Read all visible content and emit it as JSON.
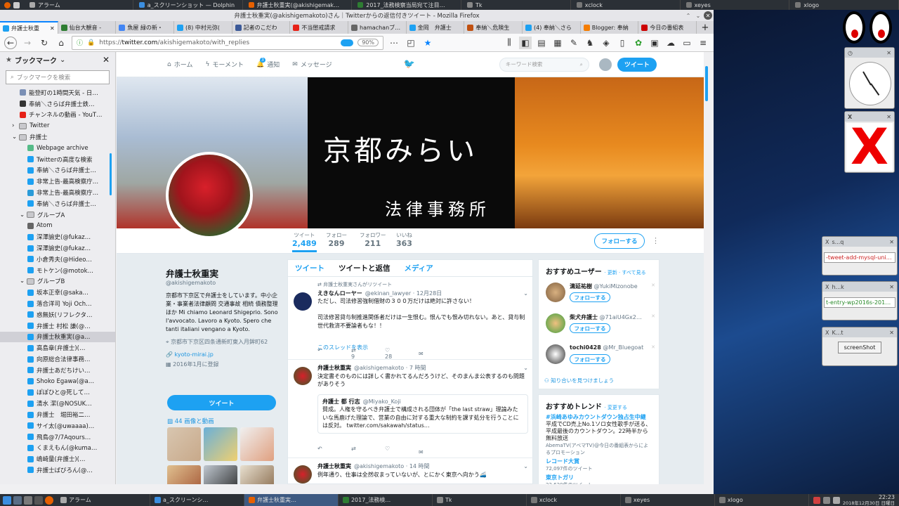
{
  "panel": {
    "items": [
      {
        "label": "アラーム"
      },
      {
        "label": "a_スクリーンショット — Dolphin"
      },
      {
        "label": "弁護士秋重実(@akishigemak…"
      },
      {
        "label": "2017_法務検察当局宛て注目…"
      },
      {
        "label": "Tk"
      },
      {
        "label": "xclock"
      },
      {
        "label": "xeyes"
      },
      {
        "label": "xlogo"
      }
    ]
  },
  "firefox": {
    "window_title": "弁護士秋重実(@akishigemakoto)さん｜Twitterからの返信付きツイート - Mozilla Firefox",
    "tabs": [
      {
        "label": "弁護士秋重"
      },
      {
        "label": "仙台大観音 - "
      },
      {
        "label": "魚屋 緑の新・"
      },
      {
        "label": "(8) 中村元弥("
      },
      {
        "label": "記者のこだわ"
      },
      {
        "label": "不当懲戒請求"
      },
      {
        "label": "hamachanブログ("
      },
      {
        "label": "金岡　弁護士"
      },
      {
        "label": "奉納＼危険生"
      },
      {
        "label": "(4) 奉納＼さら"
      },
      {
        "label": "Blogger: 奉納"
      },
      {
        "label": "今日の番組表"
      }
    ],
    "url_prefix": "https://",
    "url_domain": "twitter.com",
    "url_path": "/akishigemakoto/with_replies",
    "zoom": "90%"
  },
  "sidebar": {
    "title": "ブックマーク",
    "search_placeholder": "ブックマークを検索",
    "items": [
      {
        "label": "能登町の1時間天気 - 日…",
        "indent": 2,
        "icon": "#7a8fb5"
      },
      {
        "label": "奉納＼さらば弁護士鉄…",
        "indent": 2,
        "icon": "#333"
      },
      {
        "label": "チャンネルの動画 - YouT…",
        "indent": 2,
        "icon": "#e62117"
      },
      {
        "label": "Twitter",
        "indent": 1,
        "icon": "folder"
      },
      {
        "label": "弁護士",
        "indent": 1,
        "icon": "folder"
      },
      {
        "label": "Webpage archive",
        "indent": 3,
        "icon": "#5b8"
      },
      {
        "label": "Twitterの高度な検索",
        "indent": 3,
        "icon": "#1da1f2"
      },
      {
        "label": "奉納＼さらば弁護士…",
        "indent": 3,
        "icon": "#1da1f2"
      },
      {
        "label": "非常上告-最高検察庁…",
        "indent": 3,
        "icon": "#1da1f2"
      },
      {
        "label": "非常上告-最高検察庁…",
        "indent": 3,
        "icon": "#2a9bd8"
      },
      {
        "label": "奉納＼さらば弁護士…",
        "indent": 3,
        "icon": "#1da1f2"
      },
      {
        "label": "グループA",
        "indent": 2,
        "icon": "folder"
      },
      {
        "label": "Atom",
        "indent": 3,
        "icon": "#666"
      },
      {
        "label": "深澤諭史(@fukaz…",
        "indent": 3,
        "icon": "#1da1f2"
      },
      {
        "label": "深澤諭史(@fukaz…",
        "indent": 3,
        "icon": "#1da1f2"
      },
      {
        "label": "小倉秀夫(@Hideo…",
        "indent": 3,
        "icon": "#1da1f2"
      },
      {
        "label": "モトケン(@motok…",
        "indent": 3,
        "icon": "#1da1f2"
      },
      {
        "label": "グループB",
        "indent": 2,
        "icon": "folder"
      },
      {
        "label": "坂本正幸(@saka…",
        "indent": 3,
        "icon": "#1da1f2"
      },
      {
        "label": "落合洋司 Yoji Och…",
        "indent": 3,
        "icon": "#1da1f2"
      },
      {
        "label": "惑無妖(リフレクタ…",
        "indent": 3,
        "icon": "#1da1f2"
      },
      {
        "label": "弁護士 村松 謙(@…",
        "indent": 3,
        "icon": "#1da1f2"
      },
      {
        "label": "弁護士秋重実(@a…",
        "indent": 3,
        "icon": "#1da1f2",
        "selected": true
      },
      {
        "label": "高島章(弁護士)(…",
        "indent": 3,
        "icon": "#1da1f2"
      },
      {
        "label": "向原総合法律事務…",
        "indent": 3,
        "icon": "#1da1f2"
      },
      {
        "label": "弁護士あだちけい…",
        "indent": 3,
        "icon": "#1da1f2"
      },
      {
        "label": "Shoko Egawa(@a…",
        "indent": 3,
        "icon": "#1da1f2"
      },
      {
        "label": "ぽぽひと@死して…",
        "indent": 3,
        "icon": "#1da1f2"
      },
      {
        "label": "清水 潔(@NOSUK…",
        "indent": 3,
        "icon": "#1da1f2"
      },
      {
        "label": "弁護士　堀田裕二…",
        "indent": 3,
        "icon": "#1da1f2"
      },
      {
        "label": "サイ太(@uwaaaa)…",
        "indent": 3,
        "icon": "#1da1f2"
      },
      {
        "label": "飛鳥@7/7Aqours…",
        "indent": 3,
        "icon": "#1da1f2"
      },
      {
        "label": "くまえもん(@kuma…",
        "indent": 3,
        "icon": "#1da1f2"
      },
      {
        "label": "嶋崎量(弁護士)(…",
        "indent": 3,
        "icon": "#1da1f2"
      },
      {
        "label": "弁護士ばびろん(@…",
        "indent": 3,
        "icon": "#1da1f2"
      }
    ]
  },
  "twitter": {
    "nav": {
      "home": "ホーム",
      "moments": "モーメント",
      "notifications": "通知",
      "notif_count": "3",
      "messages": "メッセージ",
      "search_placeholder": "キーワード検索",
      "tweet_button": "ツイート"
    },
    "banner": {
      "main": "京都みらい",
      "sub": "法律事務所"
    },
    "stats": [
      {
        "label": "ツイート",
        "value": "2,489"
      },
      {
        "label": "フォロー",
        "value": "289"
      },
      {
        "label": "フォロワー",
        "value": "211"
      },
      {
        "label": "いいね",
        "value": "363"
      }
    ],
    "follow_button": "フォローする",
    "profile": {
      "name": "弁護士秋重実",
      "handle": "@akishigemakoto",
      "bio": "京都市下京区で弁護士をしています。中小企業・事業者法律顧問 交通事故 相続 債務整理ほか Mi chiamo Leonard Shigeprio. Sono l'avvocato. Lavoro a Kyoto. Spero che tanti italiani vengano a Kyoto.",
      "location": "京都市下京区四条通新町東入月鉾町62",
      "website": "kyoto-mirai.jp",
      "joined": "2016年1月に登録",
      "tweet_button": "ツイート",
      "media_label": "44 画像と動画"
    },
    "timeline_tabs": [
      {
        "label": "ツイート"
      },
      {
        "label": "ツイートと返信"
      },
      {
        "label": "メディア"
      }
    ],
    "tweets": [
      {
        "context": "弁護士秋重実さんがリツイート",
        "name": "えきなんローヤー",
        "handle": "@ekinan_lawyer · 12月28日",
        "text": "ただし、司法修習強制借財の３００万だけは絶対に許さない！\n\n司法修習貸与制推進関係者だけは一生恨む。恨んでも恨み切れない。あと、貸与制世代救済不要論者もな！！",
        "show_thread": "このスレッドを表示",
        "replies": "",
        "retweets": "9",
        "likes": "28"
      },
      {
        "name": "弁護士秋重実",
        "handle": "@akishigemakoto · 7 時間",
        "text": "決定書そのものには詳しく書かれてるんだろうけど、そのまんま公表するのも問題がありそう",
        "quote_name": "弁護士 都 行志",
        "quote_handle": "@Miyako_Koji",
        "quote_text": "賛成。人権を守るべき弁護士で構成される団体が「the last straw」理論みたいな馬鹿げた理論で、営業の自由に対する重大な制約を課す処分を行うことには反対。 twitter.com/sakawah/status…",
        "replies": "",
        "retweets": "",
        "likes": ""
      },
      {
        "name": "弁護士秋重実",
        "handle": "@akishigemakoto · 14 時間",
        "text": "例年通り、仕事は全然収まっていないが、とにかく東京へ向かう🚄",
        "replies": "",
        "retweets": "",
        "likes": "1"
      }
    ],
    "who_to_follow": {
      "title": "おすすめユーザー",
      "links": "· 更新 · すべて見る",
      "users": [
        {
          "name": "溝延祐樹",
          "handle": "@YukiMizonobe",
          "button": "フォローする"
        },
        {
          "name": "柴犬弁護士",
          "handle": "@71aiU4Gx2…",
          "button": "フォローする"
        },
        {
          "name": "tochi0428",
          "handle": "@Mr_Bluegoat",
          "button": "フォローする"
        }
      ],
      "find_friends": "知り合いを見つけましょう"
    },
    "trends": {
      "title": "おすすめトレンド",
      "change": "· 変更する",
      "items": [
        {
          "tag": "#浜崎あゆみカウントダウン独占生中継",
          "desc": "平成でCD売上No.1ソロ女性歌手が送る、平成最後のカウントダウン。22時半から無料放送",
          "count": "AbemaTV(アベマTV)@今日の番組表からによるプロモーション"
        },
        {
          "tag": "レコード大賞",
          "desc": "",
          "count": "72,097件のツイート"
        },
        {
          "tag": "東京トガリ",
          "desc": "",
          "count": "22,620件のツイート"
        }
      ]
    }
  },
  "widgets": {
    "w1": {
      "title": "s...q",
      "text": "-tweet-add-mysql-uniq.ht"
    },
    "w2": {
      "title": "h...k",
      "text": "t-entry-wp2016s-20161("
    },
    "w3": {
      "title": "K...t",
      "button": "screenShot"
    }
  },
  "taskbar": {
    "items": [
      {
        "label": "アラーム"
      },
      {
        "label": "a_スクリーンシ…"
      },
      {
        "label": "弁護士秋重実…"
      },
      {
        "label": "2017_法務検…"
      },
      {
        "label": "Tk"
      },
      {
        "label": "xclock"
      },
      {
        "label": "xeyes"
      },
      {
        "label": "xlogo"
      }
    ],
    "time": "22:23",
    "date": "2018年12月30日 日曜日"
  },
  "colors": {
    "twitter_blue": "#1da1f2",
    "firefox_blue": "#0a84ff"
  }
}
